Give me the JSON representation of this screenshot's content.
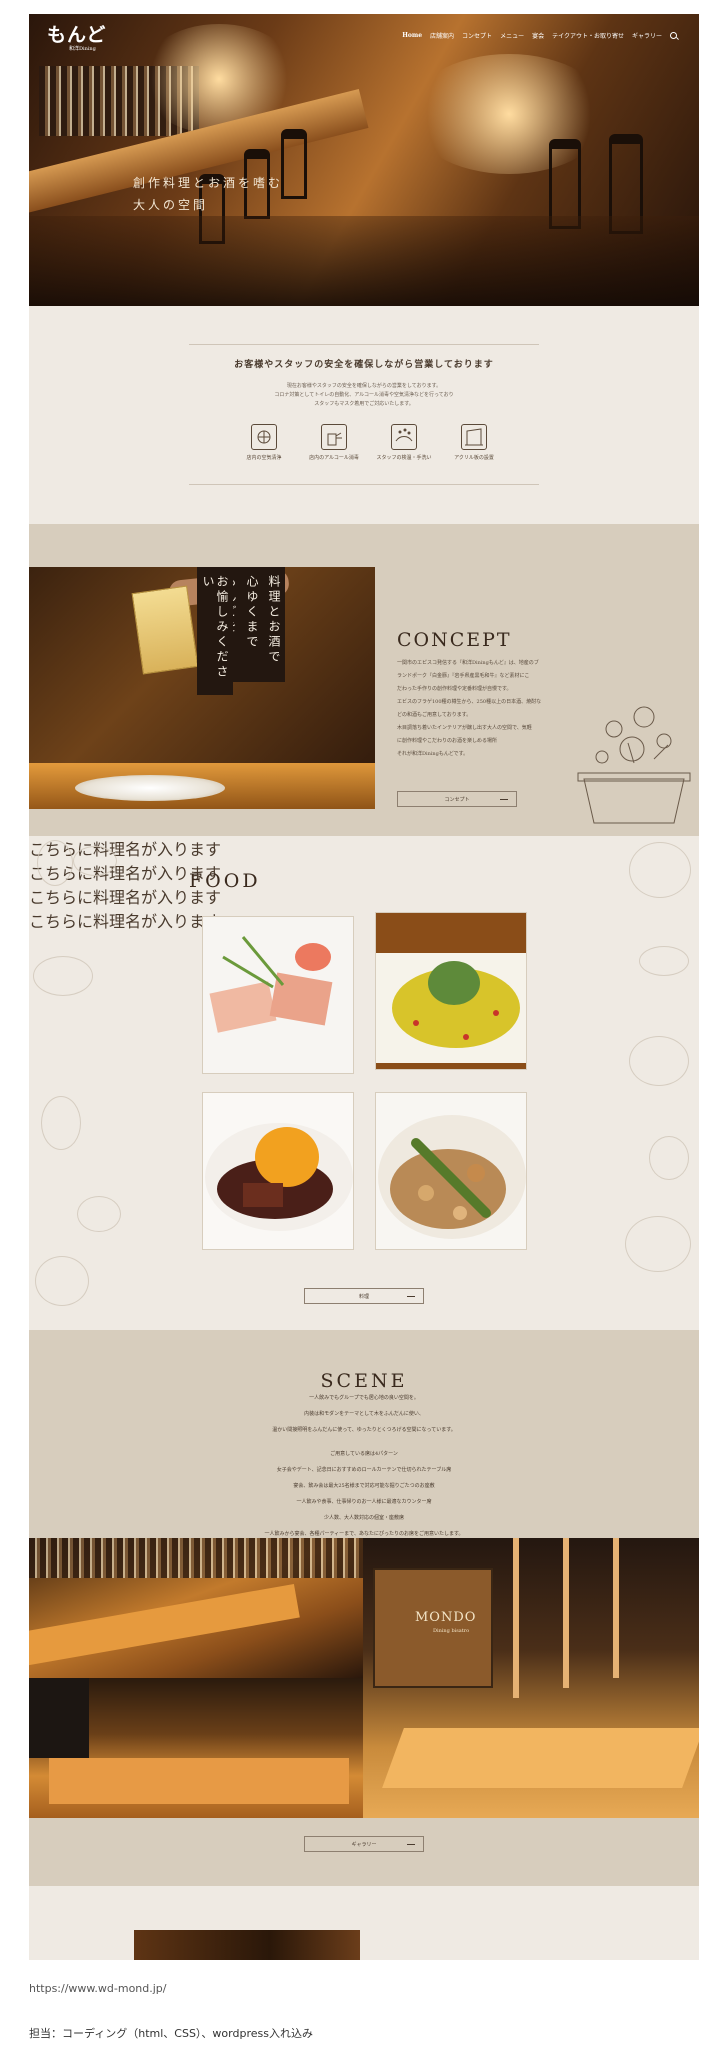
{
  "site": {
    "logo": "もんど",
    "logo_sub": "和洋Dining",
    "nav": [
      "Home",
      "店舗案内",
      "コンセプト",
      "メニュー",
      "宴会",
      "テイクアウト・お取り寄せ",
      "ギャラリー"
    ]
  },
  "hero": {
    "copy_line1": "創作料理とお酒を嗜む",
    "copy_line2": "大人の空間"
  },
  "notice": {
    "title": "お客様やスタッフの安全を確保しながら営業しております",
    "body_line1": "現在お客様やスタッフの安全を確保しながらの営業をしております。",
    "body_line2": "コロナ対策としてトイレの自動化、アルコール消毒や空気清浄などを行っており",
    "body_line3": "スタッフもマスク着用でご対応いたします。",
    "measures": [
      "店内の空気清浄",
      "店内のアルコール消毒",
      "スタッフの検温・手洗い",
      "アクリル板の設置"
    ]
  },
  "concept": {
    "vertical_line1": "料理とお酒で",
    "vertical_line2": "心ゆくまで",
    "vertical_line3": "もんどを",
    "vertical_line4": "お愉しみください",
    "heading": "CONCEPT",
    "body": [
      "一関市のエピスコ発信する『和洋Diningもんど』は、地産のブ",
      "ランドポーク『白金豚』『岩手県産黒毛和牛』など素材にこ",
      "だわった手作りの創作料理や定番料理が自慢です。",
      "エビスのフラゲ100種の樽生から、250種以上の日本酒、焼酎な",
      "どの和酒もご用意しております。",
      "木目調落ち着いたインテリアが醸し出す大人の空間で、気軽",
      "に創作料理やこだわりのお酒を楽しめる場所",
      "それが和洋Diningもんどです。"
    ],
    "button": "コンセプト"
  },
  "food": {
    "heading": "FOOD",
    "captions": [
      "こちらに料理名が入ります",
      "こちらに料理名が入ります",
      "こちらに料理名が入ります",
      "こちらに料理名が入ります"
    ],
    "button": "料理"
  },
  "scene": {
    "heading": "SCENE",
    "intro": [
      "一人飲みでもグループでも居心地の良い空間を。",
      "内装は和モダンをテーマとして木をふんだんに使い、",
      "温かい間接照明をふんだんに使って、ゆったりとくつろげる空間になっています。"
    ],
    "patterns_title": "ご用意している席は4パターン",
    "patterns": [
      "女子会やデート、記念日におすすめのロールカーテンで仕切られたテーブル席",
      "宴会、飲み会は最大25名様まで対応可能な掘りごたつのお座敷",
      "一人飲みや食事、仕事帰りのお一人様に最適なカウンター席",
      "少人数、大人数対応の個室・座敷席",
      "一人飲みから宴会、各種パーティーまで、あなたにぴったりのお席をご用意いたします。"
    ],
    "sign": "MONDO",
    "sign_sub": "Dining bisatro",
    "button": "ギャラリー"
  },
  "caption": {
    "url": "https://www.wd-mond.jp/",
    "role": "担当：コーディング（html、CSS）、wordpress入れ込み"
  }
}
